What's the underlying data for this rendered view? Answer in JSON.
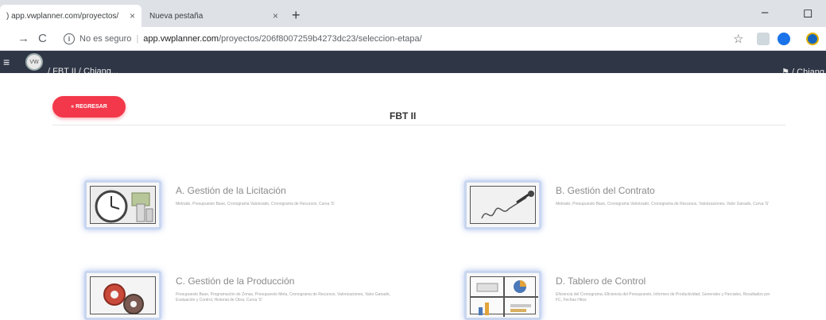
{
  "browser": {
    "tabs": [
      {
        "title": ") app.vwplanner.com/proyectos/",
        "close": "×",
        "active": true
      },
      {
        "title": "Nueva pestaña",
        "close": "×",
        "active": false
      }
    ],
    "new_tab": "+",
    "window_controls": {
      "minimize": "–",
      "maximize": "◻"
    },
    "nav": {
      "back": "→",
      "reload": "C"
    },
    "address": {
      "info": "i",
      "security": "No es seguro",
      "host": "app.vwplanner.com",
      "path": "/proyectos/206f8007259b4273dc23/seleccion-etapa/"
    },
    "star": "☆"
  },
  "appbar": {
    "menu_icon": "≡",
    "logo_text": "VW",
    "breadcrumb": "/ FBT II / Chiang...",
    "user": "⚑ / Chiang"
  },
  "page": {
    "back_button": "« REGRESAR",
    "title": "FBT II"
  },
  "cards": [
    {
      "title": "A. Gestión de la Licitación",
      "desc": "Metrado, Presupuesto Base, Cronograma Valorizado, Cronograma de Recursos, Curva 'S'",
      "icon": "clock-money-icon"
    },
    {
      "title": "B. Gestión del Contrato",
      "desc": "Metrado, Presupuesto Base, Cronograma Valorizado, Cronograma de Recursos, Valorizaciones, Valor Ganado, Curva 'S'",
      "icon": "signature-icon"
    },
    {
      "title": "C. Gestión de la Producción",
      "desc": "Presupuesto Base, Programación de Zonas, Presupuesto Meta, Cronograma de Recursos, Valorizaciones, Valor Ganado, Evaluación y Control, Historial de Obra, Curva 'S'",
      "icon": "gears-icon"
    },
    {
      "title": "D. Tablero de Control",
      "desc": "Eficiencia del Cronograma, Eficiencia del Presupuesto, Informes de Productividad, Generales y Parciales, Resultados por FC, Fechas Hitos",
      "icon": "dashboard-icon"
    }
  ],
  "colors": {
    "accent": "#f2384a",
    "appbar": "#2f3646"
  }
}
